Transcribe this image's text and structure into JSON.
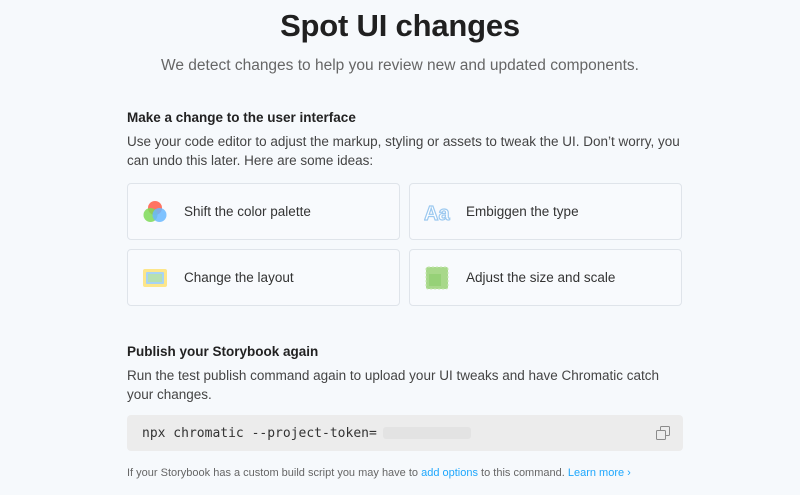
{
  "header": {
    "title": "Spot UI changes",
    "subtitle": "We detect changes to help you review new and updated components."
  },
  "section_change": {
    "heading": "Make a change to the user interface",
    "description": "Use your code editor to adjust the markup, styling or assets to tweak the UI. Don’t worry, you can undo this later. Here are some ideas:"
  },
  "ideas": [
    {
      "label": "Shift the color palette",
      "icon": "color-palette-icon"
    },
    {
      "label": "Embiggen the type",
      "icon": "type-icon"
    },
    {
      "label": "Change the layout",
      "icon": "layout-icon"
    },
    {
      "label": "Adjust the size and scale",
      "icon": "scale-icon"
    }
  ],
  "icon_text": {
    "type_glyph": "Aa"
  },
  "section_publish": {
    "heading": "Publish your Storybook again",
    "description": "Run the test publish command again to upload your UI tweaks and have Chromatic catch your changes."
  },
  "command": {
    "text": "npx chromatic --project-token="
  },
  "note": {
    "prefix": "If your Storybook has a custom build script you may have to ",
    "link": "add options",
    "suffix": " to this command. ",
    "learn_more": "Learn more ›"
  },
  "colors": {
    "background": "#f6f9fc",
    "link": "#1ea7fd",
    "card_border": "#dfe4ea",
    "code_bg": "#ececec"
  }
}
